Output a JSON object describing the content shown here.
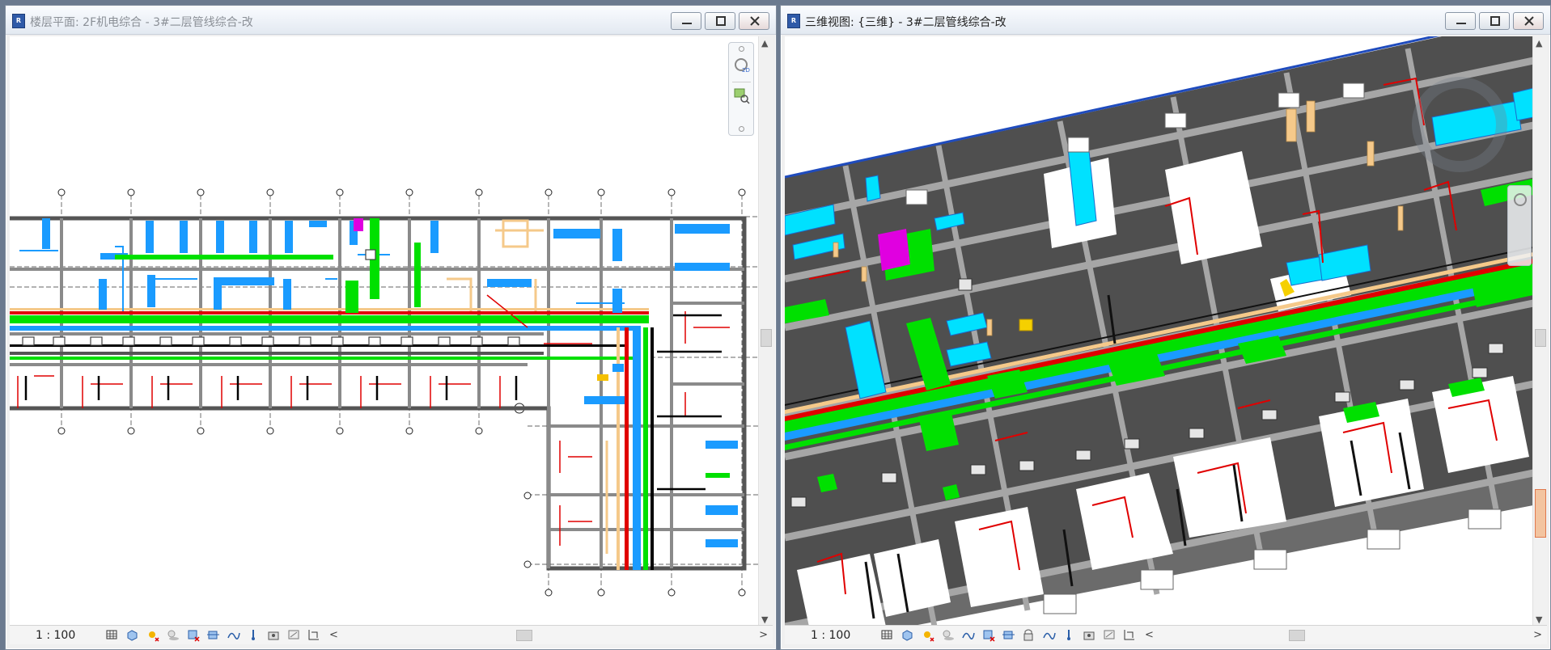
{
  "left_window": {
    "title": "楼层平面: 2F机电综合 - 3#二层管线综合-改",
    "scale": "1 : 100",
    "view_type": "floor-plan"
  },
  "right_window": {
    "title": "三维视图: {三维} - 3#二层管线综合-改",
    "scale": "1 : 100",
    "view_type": "3d-view"
  },
  "icons": {
    "window_buttons": [
      "minimize-icon",
      "maximize-icon",
      "close-icon"
    ],
    "view_controls_left": [
      "detail-level-icon",
      "visual-style-icon",
      "sun-path-icon",
      "shadows-icon",
      "crop-view-icon",
      "show-crop-icon",
      "temporary-hide-icon",
      "reveal-hidden-icon",
      "lock-3d-icon",
      "analytical-model-icon",
      "highlight-displacement-icon"
    ],
    "view_controls_right": [
      "detail-level-icon",
      "visual-style-icon",
      "sun-path-icon",
      "shadows-icon",
      "render-icon",
      "crop-view-icon",
      "show-crop-icon",
      "lock-3d-icon",
      "temporary-hide-icon",
      "reveal-hidden-icon",
      "analytical-model-icon",
      "highlight-displacement-icon",
      "worksharing-icon"
    ]
  },
  "colors": {
    "duct_supply": "#1a9bff",
    "duct_cyan": "#00e1ff",
    "pipe_fire": "#e00000",
    "cable_tray": "#00e000",
    "pipe_drain": "#000000",
    "pipe_hotwater": "#f5c98a",
    "pipe_magenta": "#e000e0",
    "wall_3d": "#8c8c8c",
    "floor_3d": "#5e5e5e"
  }
}
